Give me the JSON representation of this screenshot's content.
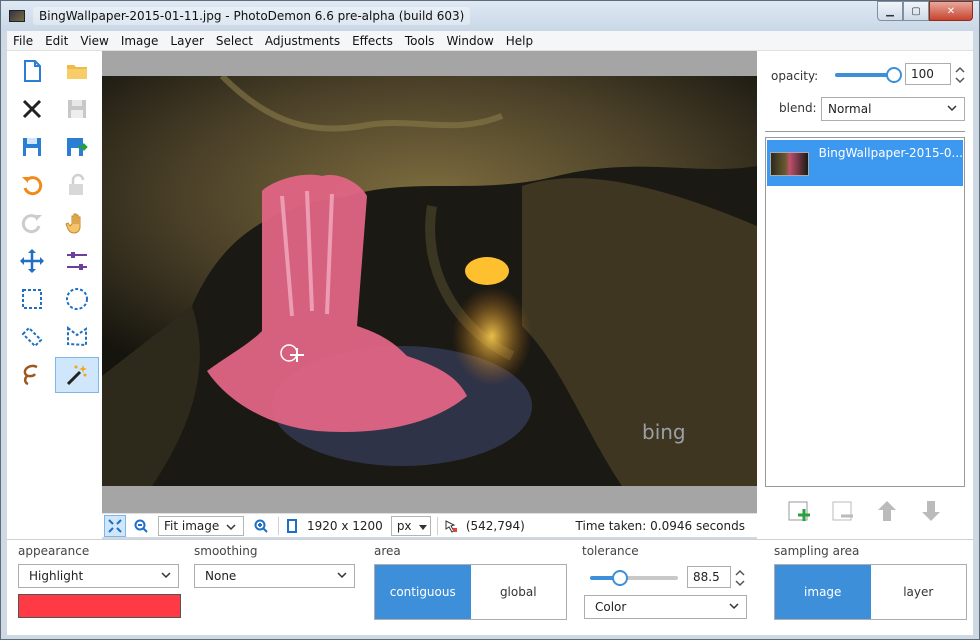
{
  "window": {
    "title": "BingWallpaper-2015-01-11.jpg  -  PhotoDemon 6.6 pre-alpha (build 603)",
    "controls": {
      "minimize": "▁",
      "maximize": "▢",
      "close": "✕"
    }
  },
  "menu": [
    "File",
    "Edit",
    "View",
    "Image",
    "Layer",
    "Select",
    "Adjustments",
    "Effects",
    "Tools",
    "Window",
    "Help"
  ],
  "toolbox": [
    {
      "name": "new-image",
      "icon": "new-document-icon"
    },
    {
      "name": "open-image",
      "icon": "folder-icon"
    },
    {
      "name": "close-image",
      "icon": "close-icon"
    },
    {
      "name": "save",
      "icon": "save-icon"
    },
    {
      "name": "save-as",
      "icon": "save-as-icon"
    },
    {
      "name": "export",
      "icon": "export-icon"
    },
    {
      "name": "undo",
      "icon": "undo-icon"
    },
    {
      "name": "undo-history",
      "icon": "lock-icon"
    },
    {
      "name": "redo",
      "icon": "redo-icon"
    },
    {
      "name": "hand-tool",
      "icon": "hand-icon"
    },
    {
      "name": "move-tool",
      "icon": "move-icon"
    },
    {
      "name": "adjust-tool",
      "icon": "sliders-icon"
    },
    {
      "name": "rect-select",
      "icon": "rect-select-icon"
    },
    {
      "name": "ellipse-select",
      "icon": "ellipse-select-icon"
    },
    {
      "name": "line-select",
      "icon": "line-select-icon"
    },
    {
      "name": "polygon-select",
      "icon": "polygon-select-icon"
    },
    {
      "name": "lasso-select",
      "icon": "lasso-icon"
    },
    {
      "name": "magic-wand",
      "icon": "magic-wand-icon"
    }
  ],
  "status": {
    "zoom_value": "Fit image",
    "image_size": "1920 x 1200",
    "unit": "px",
    "cursor_pos": "(542,794)",
    "time_taken": "Time taken: 0.0946 seconds"
  },
  "canvas": {
    "watermark": "bing"
  },
  "right_panel": {
    "opacity_label": "opacity:",
    "opacity_value": "100",
    "opacity_fraction": 1.0,
    "blend_label": "blend:",
    "blend_value": "Normal",
    "layers": [
      {
        "name": "BingWallpaper-2015-0..."
      }
    ]
  },
  "options": {
    "appearance_label": "appearance",
    "appearance_value": "Highlight",
    "highlight_color": "#ff3a45",
    "smoothing_label": "smoothing",
    "smoothing_value": "None",
    "area_label": "area",
    "area_options": [
      "contiguous",
      "global"
    ],
    "area_selected": "contiguous",
    "tolerance_label": "tolerance",
    "tolerance_value": "88.5",
    "tolerance_fraction": 0.3,
    "compare_value": "Color",
    "sampling_label": "sampling area",
    "sampling_options": [
      "image",
      "layer"
    ],
    "sampling_selected": "image"
  },
  "colors": {
    "accent": "#3d8fd9",
    "selected_layer": "#3d99f0"
  }
}
